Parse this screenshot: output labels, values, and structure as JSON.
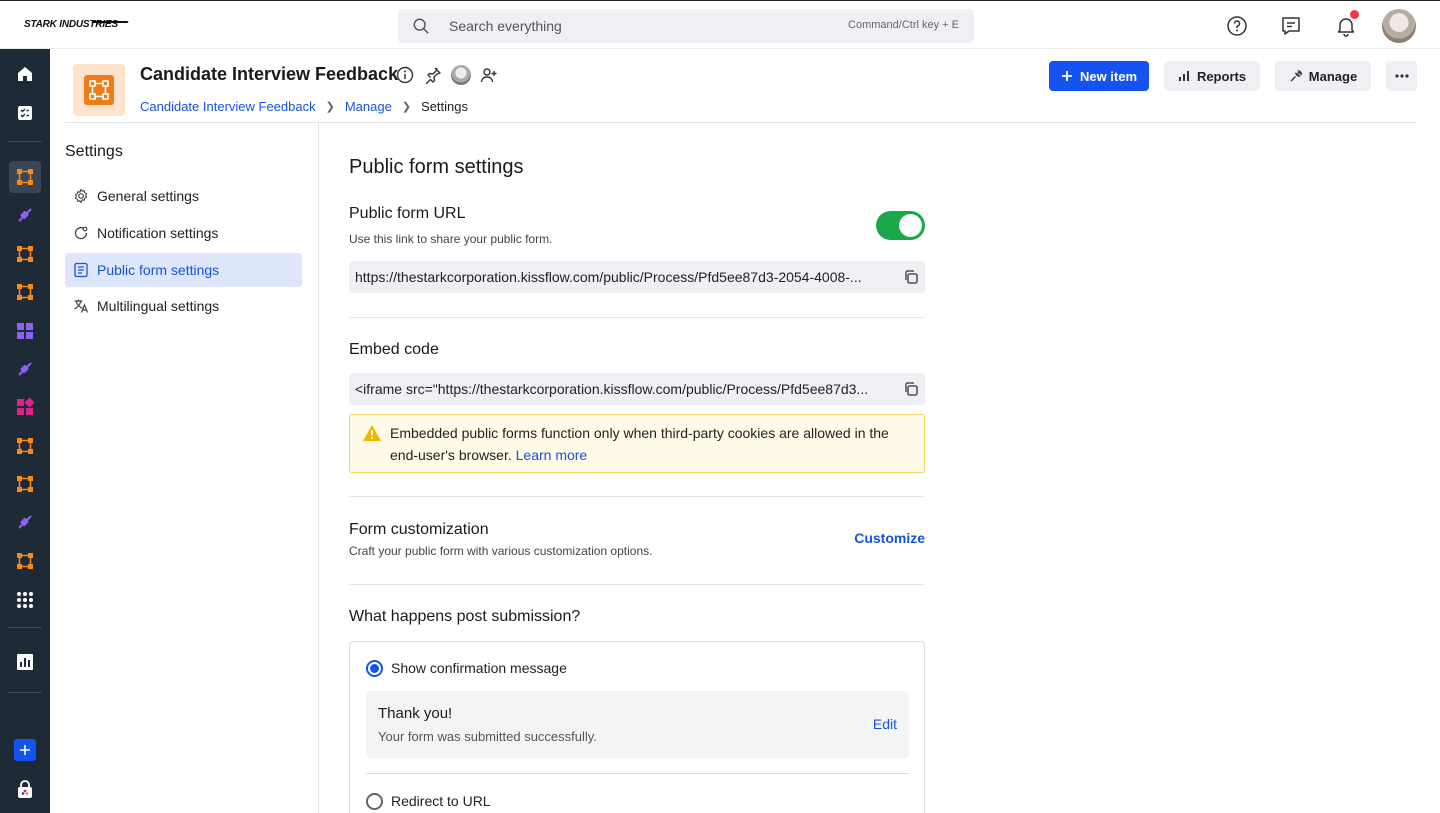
{
  "brand": {
    "logo_text": "STARK INDUSTRIES"
  },
  "search": {
    "placeholder": "Search everything",
    "shortcut_hint": "Command/Ctrl key + E"
  },
  "header": {
    "title": "Candidate Interview Feedback",
    "breadcrumb": [
      "Candidate Interview Feedback",
      "Manage",
      "Settings"
    ],
    "buttons": {
      "new_item": "New item",
      "reports": "Reports",
      "manage": "Manage"
    }
  },
  "settings_nav": {
    "title": "Settings",
    "items": [
      {
        "label": "General settings",
        "icon": "gear-icon"
      },
      {
        "label": "Notification settings",
        "icon": "bell-icon"
      },
      {
        "label": "Public form settings",
        "icon": "form-icon",
        "active": true
      },
      {
        "label": "Multilingual settings",
        "icon": "translate-icon"
      }
    ]
  },
  "main": {
    "heading": "Public form settings",
    "public_url": {
      "title": "Public form URL",
      "subtitle": "Use this link to share your public form.",
      "enabled": true,
      "value": "https://thestarkcorporation.kissflow.com/public/Process/Pfd5ee87d3-2054-4008-..."
    },
    "embed": {
      "title": "Embed code",
      "value": "<iframe src=\"https://thestarkcorporation.kissflow.com/public/Process/Pfd5ee87d3...",
      "warning": "Embedded public forms function only when third-party cookies are allowed in the end-user's browser.",
      "learn_more": "Learn more"
    },
    "customization": {
      "title": "Form customization",
      "subtitle": "Craft your public form with various customization options.",
      "action": "Customize"
    },
    "post_submission": {
      "title": "What happens post submission?",
      "options": [
        {
          "label": "Show confirmation message",
          "selected": true
        },
        {
          "label": "Redirect to URL",
          "selected": false
        }
      ],
      "message_title": "Thank you!",
      "message_body": "Your form was submitted successfully.",
      "edit": "Edit"
    }
  },
  "colors": {
    "accent": "#1553f0",
    "toggle_on": "#1aa84a",
    "rail": "#1f2a37",
    "app_orange": "#f07c19"
  }
}
